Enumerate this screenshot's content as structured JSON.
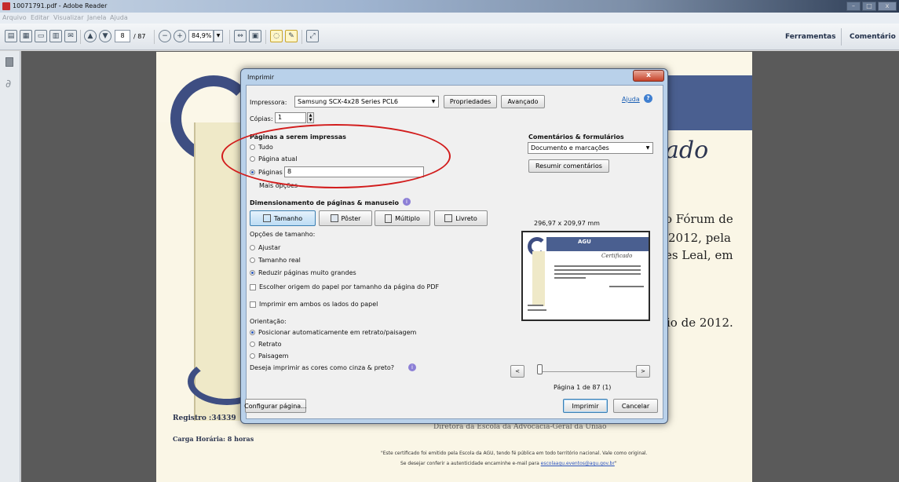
{
  "window": {
    "title": "10071791.pdf - Adobe Reader",
    "app_icon": "pdf-icon"
  },
  "menu": [
    "Arquivo",
    "Editar",
    "Visualizar",
    "Janela",
    "Ajuda"
  ],
  "toolbar": {
    "page_current": "8",
    "page_total": "/ 87",
    "zoom": "84,9%",
    "ferramentas": "Ferramentas",
    "comentario": "Comentário"
  },
  "doc": {
    "heading_partial": "ado",
    "line1": "o Fórum de",
    "line2": "2012, pela",
    "line3": "es Leal, em",
    "line4": "io de 2012.",
    "registro": "Registro :34339",
    "carga": "Carga Horária: 8 horas",
    "diretora": "Diretora da Escola da Advocacia-Geral da União",
    "footer1": "\"Este certificado foi emitido pela Escola da AGU, tendo fé pública em todo território nacional. Vale como original.",
    "footer2_prefix": "Se desejar conferir a autenticidade encaminhe e-mail para ",
    "footer2_link": "escolaagu.eventos@agu.gov.br",
    "footer2_suffix": "\""
  },
  "dialog": {
    "title": "Imprimir",
    "impressora_label": "Impressora:",
    "impressora_value": "Samsung SCX-4x28 Series PCL6",
    "propriedades": "Propriedades",
    "avancado": "Avançado",
    "ajuda": "Ajuda",
    "copias_label": "Cópias:",
    "copias_value": "1",
    "paginas_heading": "Páginas a serem impressas",
    "tudo": "Tudo",
    "pagina_atual": "Página atual",
    "paginas": "Páginas",
    "paginas_value": "8",
    "mais_opcoes": "Mais opções",
    "comentarios_heading": "Comentários & formulários",
    "comentarios_value": "Documento e marcações",
    "resumir": "Resumir comentários",
    "dimensionamento": "Dimensionamento de páginas & manuseio",
    "tamanho": "Tamanho",
    "poster": "Pôster",
    "multiplo": "Múltiplo",
    "livreto": "Livreto",
    "opcoes_tamanho": "Opções de tamanho:",
    "ajustar": "Ajustar",
    "tamanho_real": "Tamanho real",
    "reduzir": "Reduzir páginas muito grandes",
    "escolher": "Escolher origem do papel por tamanho da página do PDF",
    "ambos": "Imprimir em ambos os lados do papel",
    "orientacao": "Orientação:",
    "posicionar": "Posicionar automaticamente em retrato/paisagem",
    "retrato": "Retrato",
    "paisagem": "Paisagem",
    "cinza": "Deseja imprimir as cores como cinza & preto?",
    "preview_size": "296,97 x 209,97 mm",
    "preview_brand": "AGU",
    "preview_cert": "Certificado",
    "pagina_info": "Página 1 de 87 (1)",
    "configurar": "Configurar página...",
    "imprimir": "Imprimir",
    "cancelar": "Cancelar",
    "close": "x"
  },
  "colors": {
    "accent_red": "#d21c1c",
    "dialog_blue": "#b9d1ea",
    "brand_navy": "#4a5f90"
  }
}
